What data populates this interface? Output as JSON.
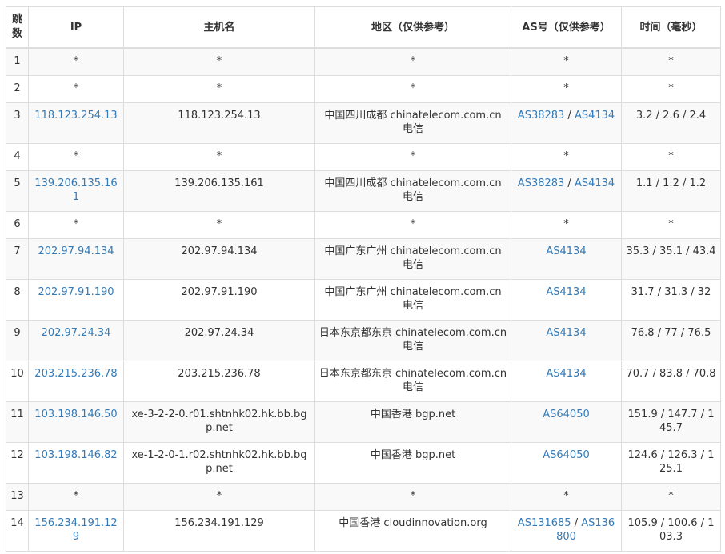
{
  "headers": {
    "hop": "跳\n数",
    "ip": "IP",
    "hostname": "主机名",
    "region": "地区（仅供参考）",
    "as": "AS号（仅供参考）",
    "time": "时间（毫秒）"
  },
  "colors": {
    "link": "#337ab7",
    "stripe": "#f9f9f9",
    "border": "#dddddd",
    "text": "#333333"
  },
  "rows": [
    {
      "hop": "1",
      "ip": "*",
      "ip_link": false,
      "host": "*",
      "region": "*",
      "asn": [
        "*"
      ],
      "asn_link": false,
      "time": "*"
    },
    {
      "hop": "2",
      "ip": "*",
      "ip_link": false,
      "host": "*",
      "region": "*",
      "asn": [
        "*"
      ],
      "asn_link": false,
      "time": "*"
    },
    {
      "hop": "3",
      "ip": "118.123.254.13",
      "ip_link": true,
      "host": "118.123.254.13",
      "region": "中国四川成都 chinatelecom.com.cn 电信",
      "asn": [
        "AS38283",
        "AS4134"
      ],
      "asn_link": true,
      "time": "3.2 / 2.6 / 2.4"
    },
    {
      "hop": "4",
      "ip": "*",
      "ip_link": false,
      "host": "*",
      "region": "*",
      "asn": [
        "*"
      ],
      "asn_link": false,
      "time": "*"
    },
    {
      "hop": "5",
      "ip": "139.206.135.161",
      "ip_link": true,
      "host": "139.206.135.161",
      "region": "中国四川成都 chinatelecom.com.cn 电信",
      "asn": [
        "AS38283",
        "AS4134"
      ],
      "asn_link": true,
      "time": "1.1 / 1.2 / 1.2"
    },
    {
      "hop": "6",
      "ip": "*",
      "ip_link": false,
      "host": "*",
      "region": "*",
      "asn": [
        "*"
      ],
      "asn_link": false,
      "time": "*"
    },
    {
      "hop": "7",
      "ip": "202.97.94.134",
      "ip_link": true,
      "host": "202.97.94.134",
      "region": "中国广东广州 chinatelecom.com.cn 电信",
      "asn": [
        "AS4134"
      ],
      "asn_link": true,
      "time": "35.3 / 35.1 / 43.4"
    },
    {
      "hop": "8",
      "ip": "202.97.91.190",
      "ip_link": true,
      "host": "202.97.91.190",
      "region": "中国广东广州 chinatelecom.com.cn 电信",
      "asn": [
        "AS4134"
      ],
      "asn_link": true,
      "time": "31.7 / 31.3 / 32"
    },
    {
      "hop": "9",
      "ip": "202.97.24.34",
      "ip_link": true,
      "host": "202.97.24.34",
      "region": "日本东京都东京 chinatelecom.com.cn 电信",
      "asn": [
        "AS4134"
      ],
      "asn_link": true,
      "time": "76.8 / 77 / 76.5"
    },
    {
      "hop": "10",
      "ip": "203.215.236.78",
      "ip_link": true,
      "host": "203.215.236.78",
      "region": "日本东京都东京 chinatelecom.com.cn 电信",
      "asn": [
        "AS4134"
      ],
      "asn_link": true,
      "time": "70.7 / 83.8 / 70.8"
    },
    {
      "hop": "11",
      "ip": "103.198.146.50",
      "ip_link": true,
      "host": "xe-3-2-2-0.r01.shtnhk02.hk.bb.bgp.net",
      "region": "中国香港 bgp.net",
      "asn": [
        "AS64050"
      ],
      "asn_link": true,
      "time": "151.9 / 147.7 / 145.7"
    },
    {
      "hop": "12",
      "ip": "103.198.146.82",
      "ip_link": true,
      "host": "xe-1-2-0-1.r02.shtnhk02.hk.bb.bgp.net",
      "region": "中国香港 bgp.net",
      "asn": [
        "AS64050"
      ],
      "asn_link": true,
      "time": "124.6 / 126.3 / 125.1"
    },
    {
      "hop": "13",
      "ip": "*",
      "ip_link": false,
      "host": "*",
      "region": "*",
      "asn": [
        "*"
      ],
      "asn_link": false,
      "time": "*"
    },
    {
      "hop": "14",
      "ip": "156.234.191.129",
      "ip_link": true,
      "host": "156.234.191.129",
      "region": "中国香港 cloudinnovation.org",
      "asn": [
        "AS131685",
        "AS136800"
      ],
      "asn_link": true,
      "time": "105.9 / 100.6 / 103.3"
    }
  ]
}
